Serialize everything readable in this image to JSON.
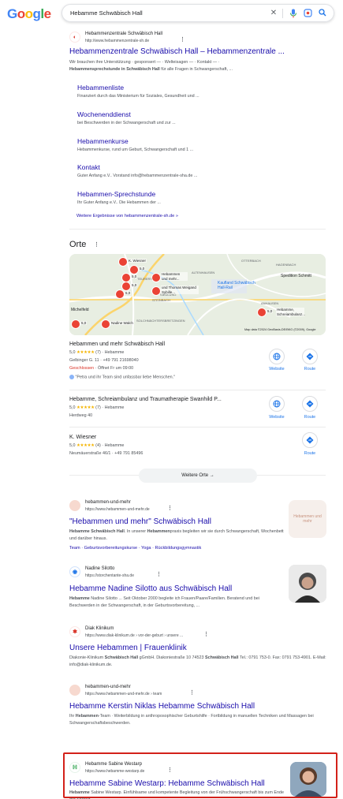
{
  "search": {
    "query": "Hebamme Schwäbisch Hall"
  },
  "logo": {
    "letters": [
      "G",
      "o",
      "o",
      "g",
      "l",
      "e"
    ],
    "colors": [
      "#4285f4",
      "#ea4335",
      "#fbbc05",
      "#4285f4",
      "#34a853",
      "#ea4335"
    ]
  },
  "result1": {
    "site_name": "Hebammenzentrale Schwäbisch Hall",
    "url": "http://www.hebammenzentrale-sh.de",
    "title": "Hebammenzentrale Schwäbisch Hall – Hebammenzentrale ...",
    "snippet_line1": "Wir brauchen ihre Unterstützung · gesponsert — · Welteisagen — · Kontakt — ·",
    "snippet_bold": "Hebammensprechstunde in Schwäbisch Hall",
    "snippet_rest": " für alle Fragen in Schwangerschaft, ...",
    "sitelinks": [
      {
        "title": "Hebammenliste",
        "snippet": "Finanziert durch das Ministerium für Soziales, Gesundheit und ..."
      },
      {
        "title": "Wochenenddienst",
        "snippet": "bei Beschwerden in der Schwangerschaft und zur ..."
      },
      {
        "title": "Hebammenkurse",
        "snippet": "Hebammenkurse, rund um Geburt, Schwangerschaft und 1 ..."
      },
      {
        "title": "Kontakt",
        "snippet": "Guter Anfang e.V.. Vorstand info@hebammenzentrale-sha.de ..."
      },
      {
        "title": "Hebammen-Sprechstunde",
        "snippet": "Ihr Guter Anfang e.V.. Die Hebammen der ..."
      }
    ],
    "more_link": "Weitere Ergebnisse von hebammenzentrale-sh.de »"
  },
  "places": {
    "title": "Orte",
    "map": {
      "pins": [
        {
          "label": "5,0"
        },
        {
          "label": "5,0"
        },
        {
          "label": "5,0"
        },
        {
          "label": "Hebammen und mehr..."
        },
        {
          "label": "und Thomas Weigand Sybille..."
        },
        {
          "label": "Nadine Walch"
        },
        {
          "label": "5,0"
        },
        {
          "label": "K. Wiesner"
        },
        {
          "label": "5,0"
        },
        {
          "label": "Hebamme, Schreiambulanz..."
        }
      ],
      "place_labels": [
        "Kaufland Schwäbisch Hall-Rail",
        "Spedition Schmitt",
        "ALTENHAUSEN",
        "OTTERBACH",
        "HAGENBACH",
        "TEURERSHOF",
        "SIEDLUNG",
        "STEINBACH",
        "ANHAUSEN",
        "SOLCHNÄCHTERSBRETZINGEN",
        "Michelfeld"
      ],
      "attribution": "Map data ©2024 GeoBasis-DE/BKG (©2009), Google"
    },
    "items": [
      {
        "name": "Hebammen und mehr Schwäbisch Hall",
        "rating": "5,0",
        "stars": "★★★★★",
        "count": "(7)",
        "category": "Hebamme",
        "address": "Gelbinger G. 11 · +49 791 21698040",
        "status": "Geschlossen",
        "hours": " · Öffnet Fr um 09:00",
        "review": "\"Petra und ihr Team sind unfassbar liebe Menschen.\"",
        "website_label": "Website",
        "route_label": "Route"
      },
      {
        "name": "Hebamme, Schreiambulanz und Traumatherapie Swanhild P...",
        "rating": "5,0",
        "stars": "★★★★★",
        "count": "(7)",
        "category": "Hebamme",
        "address": "Herdweg 40",
        "website_label": "Website",
        "route_label": "Route"
      },
      {
        "name": "K. Wiesner",
        "rating": "5,0",
        "stars": "★★★★★",
        "count": "(4)",
        "category": "Hebamme",
        "address": "Neumäuerstraße 46/1 · +49 791 85496",
        "route_label": "Route"
      }
    ],
    "more_button": "Weitere Orte →"
  },
  "results": [
    {
      "site_name": "hebammen-und-mehr",
      "url": "https://www.hebammen-und-mehr.de",
      "title": "\"Hebammen und mehr\" Schwäbisch Hall",
      "snippet": "Hebamme Schwäbisch Hall. In unserer Hebammenpraxis begleiten wir sie durch Schwangerschaft, Wochenbett und darüber hinaus.",
      "links": "Team · Geburtsvorbereitungskurse · Yoga · Rückbildungsgymnastik",
      "thumb_text": "Hebammen und mehr"
    },
    {
      "site_name": "Nadine Silotto",
      "url": "https://storchentante-sha.de",
      "title": "Hebamme Nadine Silotto aus Schwäbisch Hall",
      "snippet": "Hebamme Nadine Silotto ... Seit Oktober 2000 begleite ich Frauen/Paare/Familien. Beratend und bei Beschwerden in der Schwangerschaft, in der Geburtsvorbereitung, ..."
    },
    {
      "site_name": "Diak Klinikum",
      "url": "https://www.diak-klinikum.de › vor-der-geburt › unsere ...",
      "title": "Unsere Hebammen | Frauenklinik",
      "snippet": "Diakonie-Klinikum Schwäbisch Hall gGmbH. Diakoniestraße 10 74523 Schwäbisch Hall Tel.: 0791 753-0. Fax: 0791 753-4901. E-Mail: info@diak-klinikum.de."
    },
    {
      "site_name": "hebammen-und-mehr",
      "url": "https://www.hebammen-und-mehr.de › team",
      "title": "Hebamme Kerstin Niklas Hebamme Schwäbisch Hall",
      "snippet": "Ihr Hebammen-Team · Weiterbildung in anthroposophischer Geburtshilfe · Fortbildung in manuellen Techniken und Massagen bei Schwangerschaftsbeschwerden."
    },
    {
      "site_name": "Hebamme Sabine Westarp",
      "url": "https://www.hebamme-westarp.de",
      "title": "Hebamme Sabine Westarp: Hebamme Schwäbisch Hall",
      "snippet": "Hebamme Sabine Westarp. Einfühlsame und kompetente Begleitung von der Frühschwangerschaft bis zum Ende der Stillzeit."
    }
  ],
  "colors": {
    "link": "#1a0dab",
    "accent": "#1a73e8",
    "closed": "#d93025",
    "highlight": "#d3211a",
    "star": "#f4b400"
  }
}
